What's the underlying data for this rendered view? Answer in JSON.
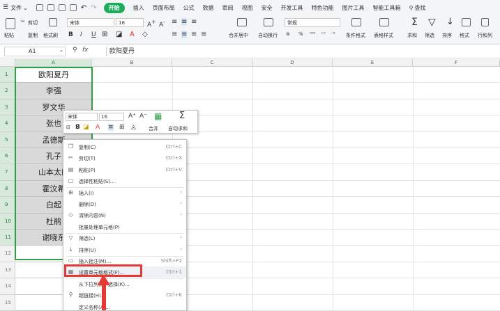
{
  "menubar": {
    "file": "文件",
    "items": [
      "开始",
      "插入",
      "页面布局",
      "公式",
      "数据",
      "审阅",
      "视图",
      "安全",
      "开发工具",
      "特色功能",
      "图片工具",
      "智能工具箱",
      "查找"
    ]
  },
  "ribbon": {
    "cut": "剪切",
    "paste": "粘贴",
    "copy": "复制",
    "format_painter": "格式刷",
    "font": "宋体",
    "size": "16",
    "bold": "B",
    "italic": "I",
    "underline": "U",
    "merge": "合并居中",
    "wrap": "自动换行",
    "number_format": "常规",
    "percent": "%",
    "cond_format": "条件格式",
    "table_style": "表格样式",
    "sum": "求和",
    "filter": "筛选",
    "sort": "排序",
    "format": "格式",
    "rows_cols": "行和列"
  },
  "formula_bar": {
    "cell_ref": "A1",
    "fx": "fx",
    "value": "欧阳夏丹"
  },
  "columns": [
    "A",
    "B",
    "C",
    "D",
    "E",
    "F"
  ],
  "rows": [
    "1",
    "2",
    "3",
    "4",
    "5",
    "6",
    "7",
    "8",
    "9",
    "10",
    "11",
    "12",
    "13",
    "14",
    "15"
  ],
  "column_a": [
    "欧阳夏丹",
    "李强",
    "罗文华",
    "张也",
    "孟德斯",
    "孔子",
    "山本太郎",
    "霍汶希",
    "白起",
    "杜鹃",
    "谢晓东"
  ],
  "mini_toolbar": {
    "font": "宋体",
    "size": "16",
    "grow": "A⁺",
    "shrink": "A⁻",
    "bold": "B",
    "merge": "合并",
    "autosum": "自动求和"
  },
  "context_menu": [
    {
      "icon": "copy-icon",
      "glyph": "❐",
      "label": "复制(C)",
      "shortcut": "Ctrl+C"
    },
    {
      "icon": "cut-icon",
      "glyph": "✂",
      "label": "剪切(T)",
      "shortcut": "Ctrl+X"
    },
    {
      "icon": "paste-icon",
      "glyph": "▤",
      "label": "粘贴(P)",
      "shortcut": "Ctrl+V"
    },
    {
      "icon": "paste-special-icon",
      "glyph": "▢",
      "label": "选择性粘贴(S)...",
      "shortcut": ""
    },
    {
      "icon": "insert-icon",
      "glyph": "⊞",
      "label": "插入(I)",
      "shortcut": ""
    },
    {
      "icon": "",
      "glyph": "",
      "label": "删除(D)",
      "shortcut": ""
    },
    {
      "icon": "clear-icon",
      "glyph": "◇",
      "label": "清除内容(N)",
      "shortcut": ""
    },
    {
      "icon": "",
      "glyph": "",
      "label": "批量处理单元格(P)",
      "shortcut": ""
    },
    {
      "icon": "filter-icon",
      "glyph": "▽",
      "label": "筛选(L)",
      "shortcut": ""
    },
    {
      "icon": "sort-icon",
      "glyph": "↓",
      "label": "排序(U)",
      "shortcut": ""
    },
    {
      "icon": "comment-icon",
      "glyph": "▭",
      "label": "插入批注(M)...",
      "shortcut": "Shift+F2"
    },
    {
      "icon": "format-cells-icon",
      "glyph": "▦",
      "label": "设置单元格格式(F)...",
      "shortcut": "Ctrl+1"
    },
    {
      "icon": "",
      "glyph": "",
      "label": "从下拉列表中选择(K)...",
      "shortcut": ""
    },
    {
      "icon": "hyperlink-icon",
      "glyph": "⚲",
      "label": "超链接(H)...",
      "shortcut": "Ctrl+K"
    },
    {
      "icon": "",
      "glyph": "",
      "label": "定义名称(A)...",
      "shortcut": ""
    }
  ],
  "colors": {
    "accent": "#1aad5c",
    "selection": "#2f9e44",
    "highlight": "#e53935"
  }
}
